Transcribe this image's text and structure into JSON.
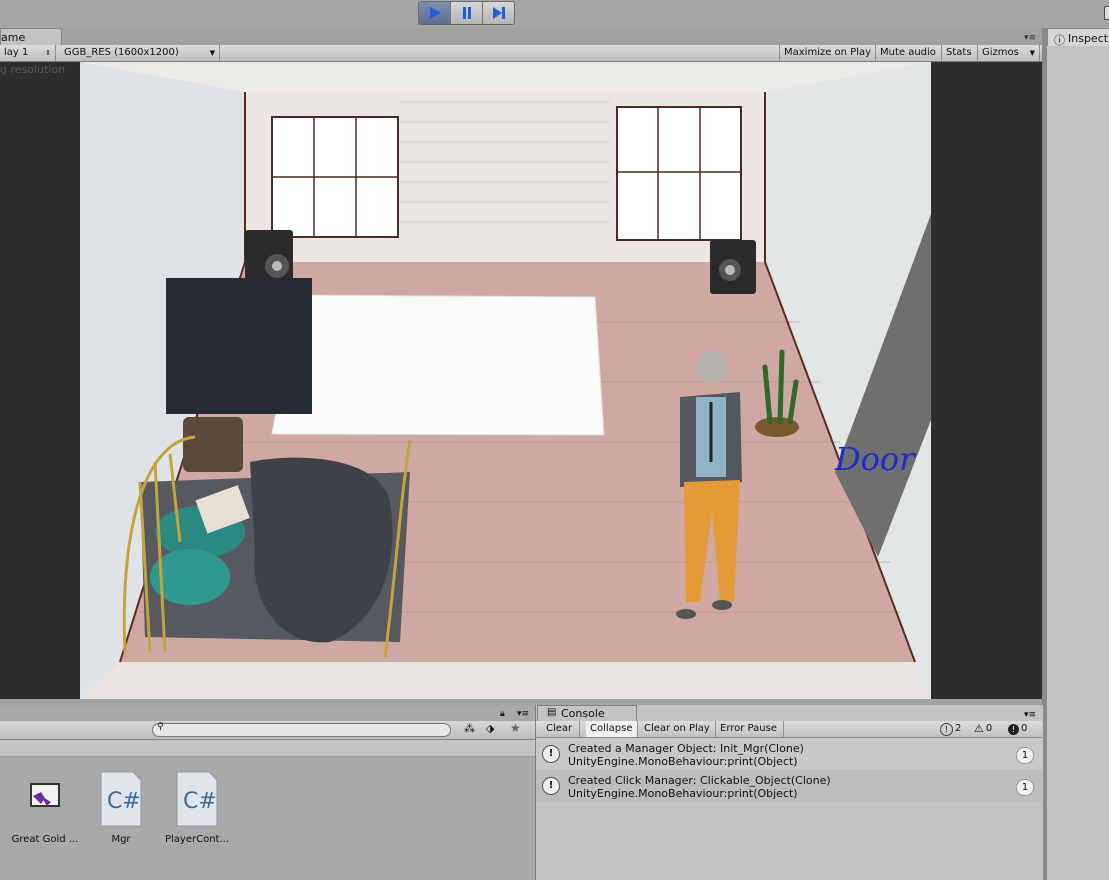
{
  "toolbar": {
    "play_icon": "play-icon",
    "pause_icon": "pause-icon",
    "step_icon": "step-icon"
  },
  "game_tab": {
    "label": "ame"
  },
  "game_toolbar": {
    "display": "lay 1",
    "resolution": "GGB_RES (1600x1200)",
    "maximize": "Maximize on Play",
    "mute": "Mute audio",
    "stats": "Stats",
    "gizmos": "Gizmos"
  },
  "viewport_hint": "g resolution",
  "scene": {
    "door_label": "Door"
  },
  "inspector": {
    "tab_label": "Inspect"
  },
  "project": {
    "assets": [
      {
        "name": "Great Gold ...",
        "icon": "visual-studio-solution-icon"
      },
      {
        "name": "Mgr",
        "icon": "csharp-script-icon"
      },
      {
        "name": "PlayerCont...",
        "icon": "csharp-script-icon"
      }
    ]
  },
  "console": {
    "tab_label": "Console",
    "buttons": {
      "clear": "Clear",
      "collapse": "Collapse",
      "clear_on_play": "Clear on Play",
      "error_pause": "Error Pause"
    },
    "counts": {
      "logs": "2",
      "warnings": "0",
      "errors": "0"
    },
    "entries": [
      {
        "line1": "Created a Manager Object: Init_Mgr(Clone)",
        "line2": "UnityEngine.MonoBehaviour:print(Object)",
        "count": "1"
      },
      {
        "line1": "Created Click Manager: Clickable_Object(Clone)",
        "line2": "UnityEngine.MonoBehaviour:print(Object)",
        "count": "1"
      }
    ]
  },
  "colors": {
    "play_active": "#5d6f8f",
    "door_text": "#1a2bd6",
    "black_square": "#262a33"
  }
}
